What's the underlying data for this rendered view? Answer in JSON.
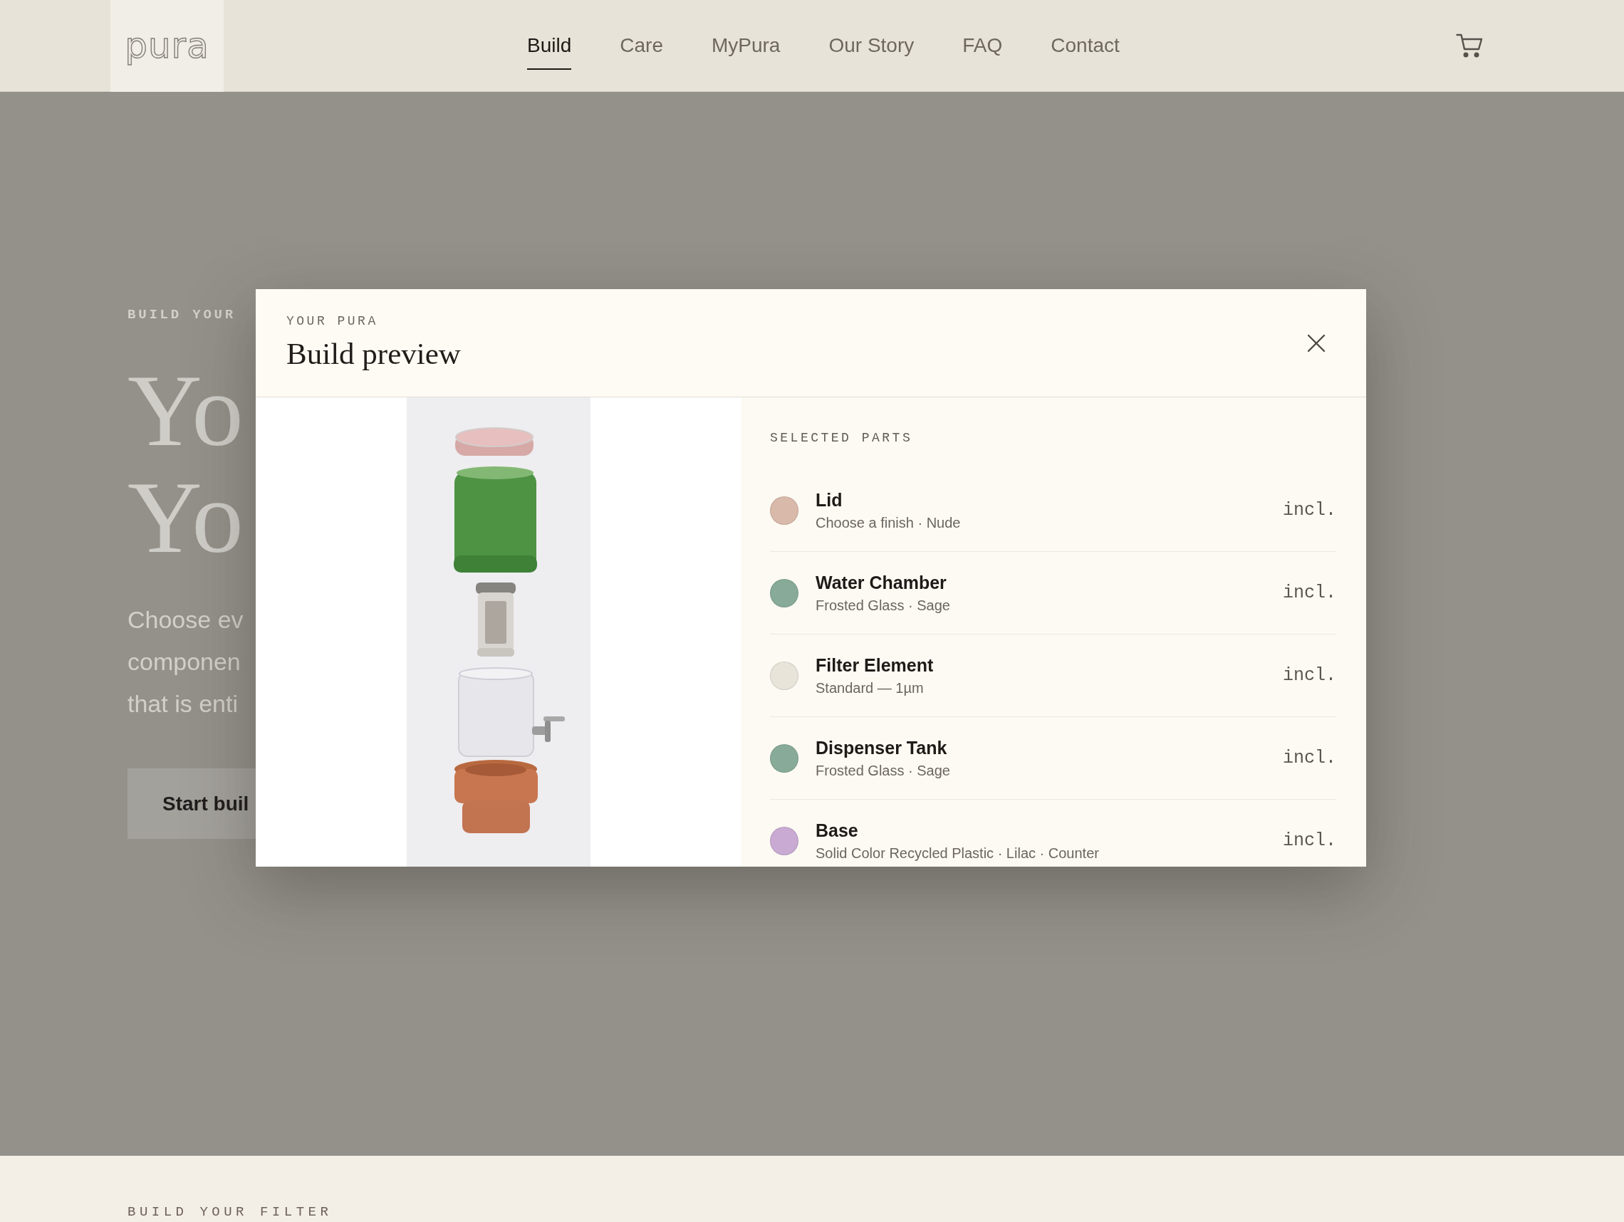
{
  "header": {
    "logo": "pura",
    "nav": [
      {
        "label": "Build",
        "selected": true
      },
      {
        "label": "Care",
        "selected": false
      },
      {
        "label": "MyPura",
        "selected": false
      },
      {
        "label": "Our Story",
        "selected": false
      },
      {
        "label": "FAQ",
        "selected": false
      },
      {
        "label": "Contact",
        "selected": false
      }
    ]
  },
  "hero": {
    "eyebrow": "BUILD YOUR",
    "heading_lines": [
      "Yo",
      "Yo"
    ],
    "paragraph_lines": [
      "Choose ev",
      "componen",
      "that is enti"
    ],
    "button": "Start buil"
  },
  "modal": {
    "eyebrow": "YOUR PURA",
    "title": "Build preview",
    "parts_heading": "SELECTED PARTS",
    "parts": [
      {
        "name": "Lid",
        "detail": "Choose a finish · Nude",
        "price": "incl.",
        "color": "#d9b9a9"
      },
      {
        "name": "Water Chamber",
        "detail": "Frosted Glass · Sage",
        "price": "incl.",
        "color": "#88ab99"
      },
      {
        "name": "Filter Element",
        "detail": "Standard — 1µm",
        "price": "incl.",
        "color": "#e9e4da"
      },
      {
        "name": "Dispenser Tank",
        "detail": "Frosted Glass · Sage",
        "price": "incl.",
        "color": "#88ab99"
      },
      {
        "name": "Base",
        "detail": "Solid Color Recycled Plastic · Lilac · Counter",
        "price": "incl.",
        "color": "#c8aad3"
      }
    ]
  },
  "footer": {
    "eyebrow": "BUILD YOUR FILTER"
  }
}
